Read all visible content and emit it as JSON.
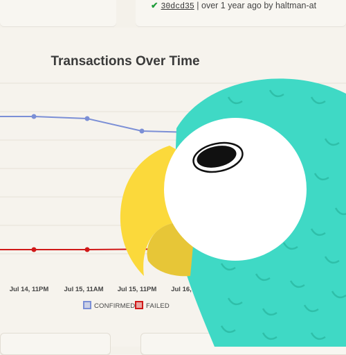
{
  "commit": {
    "check_icon": "check-icon",
    "hash": "30dcd35",
    "meta": "| over 1 year ago by haltman-at"
  },
  "chart_data": {
    "type": "line",
    "title": "Transactions Over Time",
    "x": [
      "Jul 14, 11PM",
      "Jul 15, 11AM",
      "Jul 15, 11PM",
      "Jul 16,"
    ],
    "series": [
      {
        "name": "CONFIRMED",
        "color": "#7b8fd6",
        "values": [
          3.2,
          3.15,
          2.85,
          2.82
        ]
      },
      {
        "name": "FAILED",
        "color": "#d01818",
        "values": [
          0.0,
          0.0,
          0.01,
          0.01
        ]
      }
    ],
    "grid": true,
    "legend": "bottom",
    "ylim": [
      0,
      4
    ]
  },
  "colors": {
    "confirmed": "#7b8fd6",
    "failed": "#d01818",
    "mascot_body": "#3fd9c5",
    "mascot_beak": "#fbd93b"
  },
  "mascot": {
    "icon": "parrot-mascot-icon"
  }
}
